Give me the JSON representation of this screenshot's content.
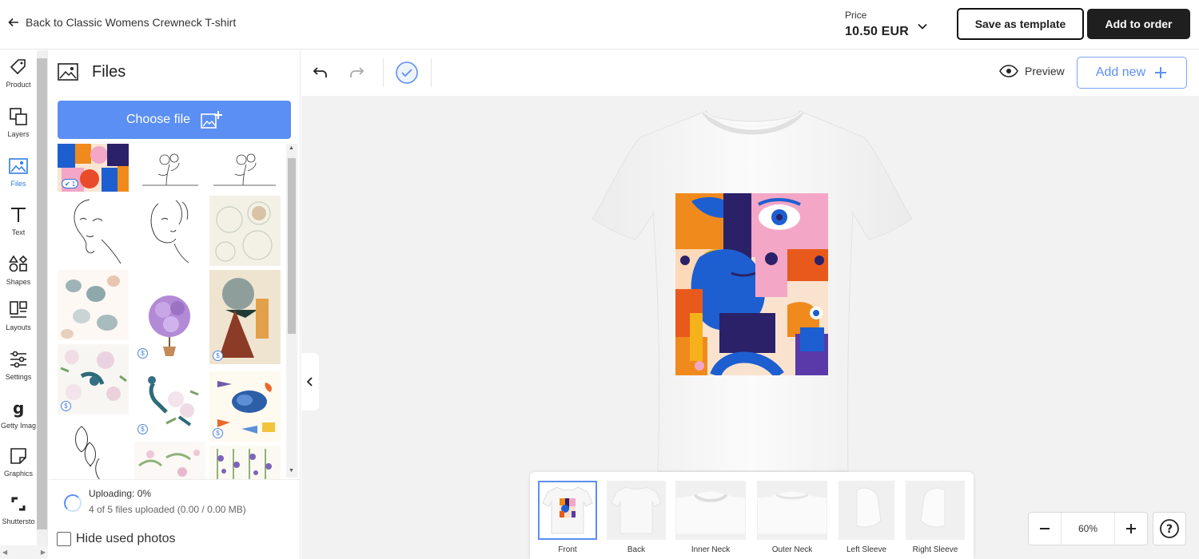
{
  "topbar": {
    "back_label": "Back to Classic Womens Crewneck T-shirt",
    "price_label": "Price",
    "price_value": "10.50 EUR",
    "save_template_label": "Save as template",
    "add_to_order_label": "Add to order"
  },
  "sidebar": {
    "items": [
      {
        "label": "Product",
        "icon": "tag-icon"
      },
      {
        "label": "Layers",
        "icon": "layers-icon"
      },
      {
        "label": "Files",
        "icon": "image-icon"
      },
      {
        "label": "Text",
        "icon": "text-icon"
      },
      {
        "label": "Shapes",
        "icon": "shapes-icon"
      },
      {
        "label": "Layouts",
        "icon": "layouts-icon"
      },
      {
        "label": "Settings",
        "icon": "sliders-icon"
      },
      {
        "label": "Getty Imag",
        "icon": "getty-icon"
      },
      {
        "label": "Graphics",
        "icon": "sticker-icon"
      },
      {
        "label": "Shuttersto",
        "icon": "shutterstock-icon"
      }
    ],
    "active": "Files"
  },
  "files_panel": {
    "title": "Files",
    "choose_file_label": "Choose file",
    "selected_badge": "1",
    "paid_marker": "$",
    "upload_status": "Uploading: 0%",
    "upload_detail": "4 of 5 files uploaded  (0.00 / 0.00 MB)",
    "hide_used_label": "Hide used photos",
    "hide_used_checked": false
  },
  "toolbar": {
    "preview_label": "Preview",
    "add_new_label": "Add new"
  },
  "views": [
    {
      "label": "Front",
      "active": true
    },
    {
      "label": "Back",
      "active": false
    },
    {
      "label": "Inner Neck",
      "active": false
    },
    {
      "label": "Outer Neck",
      "active": false
    },
    {
      "label": "Left Sleeve",
      "active": false
    },
    {
      "label": "Right Sleeve",
      "active": false
    }
  ],
  "zoom": {
    "value": "60%"
  },
  "colors": {
    "accent": "#5b8ff3",
    "dark_button": "#1f1f1f",
    "canvas_bg": "#f2f2f2"
  }
}
